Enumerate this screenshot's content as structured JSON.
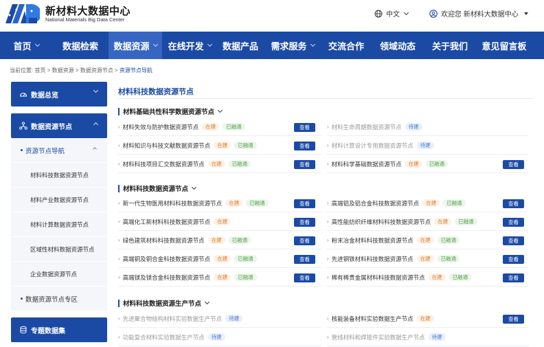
{
  "brand": {
    "name_cn": "新材料大数据中心",
    "name_en": "National Materials Big Data Center"
  },
  "topbar": {
    "language": "中文",
    "welcome": "欢迎您 新材料大数据中心"
  },
  "nav": [
    {
      "label": "首页",
      "has_dropdown": true
    },
    {
      "label": "数据检索",
      "has_dropdown": false
    },
    {
      "label": "数据资源",
      "has_dropdown": true,
      "active": true
    },
    {
      "label": "在线开发",
      "has_dropdown": true
    },
    {
      "label": "数据产品",
      "has_dropdown": false
    },
    {
      "label": "需求服务",
      "has_dropdown": true
    },
    {
      "label": "交流合作",
      "has_dropdown": false
    },
    {
      "label": "领域动态",
      "has_dropdown": false
    },
    {
      "label": "关于我们",
      "has_dropdown": false
    },
    {
      "label": "意见留言板",
      "has_dropdown": false
    }
  ],
  "breadcrumb": {
    "prefix": "当前位置: ",
    "items": [
      "首页",
      "数据资源",
      "数据资源节点"
    ],
    "current": "资源节点导航",
    "sep": " > "
  },
  "sidebar": {
    "overview": "数据总览",
    "nodes": "数据资源节点",
    "nav_group": "资源节点导航",
    "nav_items": [
      "材料科技数据资源节点",
      "材料产业数据资源节点",
      "材料计算数据资源节点",
      "区域性材料数据资源节点",
      "企业数据资源节点"
    ],
    "zone": "数据资源节点专区",
    "special": "专题数据集"
  },
  "main": {
    "title": "材料科技数据资源节点",
    "view_label": "查看",
    "sections": [
      {
        "title": "材料基础共性科学数据资源节点",
        "items": [
          {
            "name": "材料失效与防护数据资源节点",
            "tags": [
              "在建",
              "已融通"
            ],
            "view": true
          },
          {
            "name": "材料生命周期数据资源节点",
            "tags": [
              "待建"
            ],
            "view": false
          },
          {
            "name": "材料知识与科技文献数据资源节点",
            "tags": [
              "在建",
              "已融通"
            ],
            "view": true
          },
          {
            "name": "材料计算设计专用数据资源节点",
            "tags": [
              "待建"
            ],
            "view": false
          },
          {
            "name": "材料科技项目汇交数据资源节点",
            "tags": [
              "在建",
              "已融通"
            ],
            "view": true
          },
          {
            "name": "材料科学基础数据资源节点",
            "tags": [
              "在建",
              "已融通"
            ],
            "view": true
          }
        ]
      },
      {
        "title": "材料科技数据资源节点",
        "items": [
          {
            "name": "新一代生物医用材料科技数据资源节点",
            "tags": [
              "在建",
              "已融通"
            ],
            "view": true
          },
          {
            "name": "高端铝及铝合金科技数据资源节点",
            "tags": [
              "在建",
              "已融通"
            ],
            "view": true
          },
          {
            "name": "高端化工新材料科技数据资源节点",
            "tags": [
              "在建"
            ],
            "view": true
          },
          {
            "name": "高性能纺织纤维材料科技数据资源节点",
            "tags": [
              "在建",
              "已融通"
            ],
            "view": true
          },
          {
            "name": "绿色建筑材料科技数据资源节点",
            "tags": [
              "在建",
              "已融通"
            ],
            "view": true
          },
          {
            "name": "粉末冶金材料科技数据资源节点",
            "tags": [
              "在建",
              "已融通"
            ],
            "view": true
          },
          {
            "name": "高端铜及铜合金科技数据资源节点",
            "tags": [
              "在建",
              "已融通"
            ],
            "view": true
          },
          {
            "name": "先进钢铁材料科技数据资源节点",
            "tags": [
              "在建",
              "已融通"
            ],
            "view": true
          },
          {
            "name": "高端镁及镁合金科技数据资源节点",
            "tags": [
              "在建",
              "已融通"
            ],
            "view": true
          },
          {
            "name": "稀有稀贵金属材料科技数据资源节点",
            "tags": [
              "在建",
              "已融通"
            ],
            "view": true
          }
        ]
      },
      {
        "title": "材料科技数据资源生产节点",
        "items": [
          {
            "name": "先进聚合物结构材料实验数据生产节点",
            "tags": [
              "待建"
            ],
            "view": false
          },
          {
            "name": "核能装备材料实验数据生产节点",
            "tags": [
              "在建"
            ],
            "view": true
          },
          {
            "name": "功能复合材料实验数据生产节点",
            "tags": [
              "待建"
            ],
            "view": false
          },
          {
            "name": "管线材料和焊接件实验数据生产节点",
            "tags": [
              "待建"
            ],
            "view": false
          }
        ]
      }
    ]
  }
}
